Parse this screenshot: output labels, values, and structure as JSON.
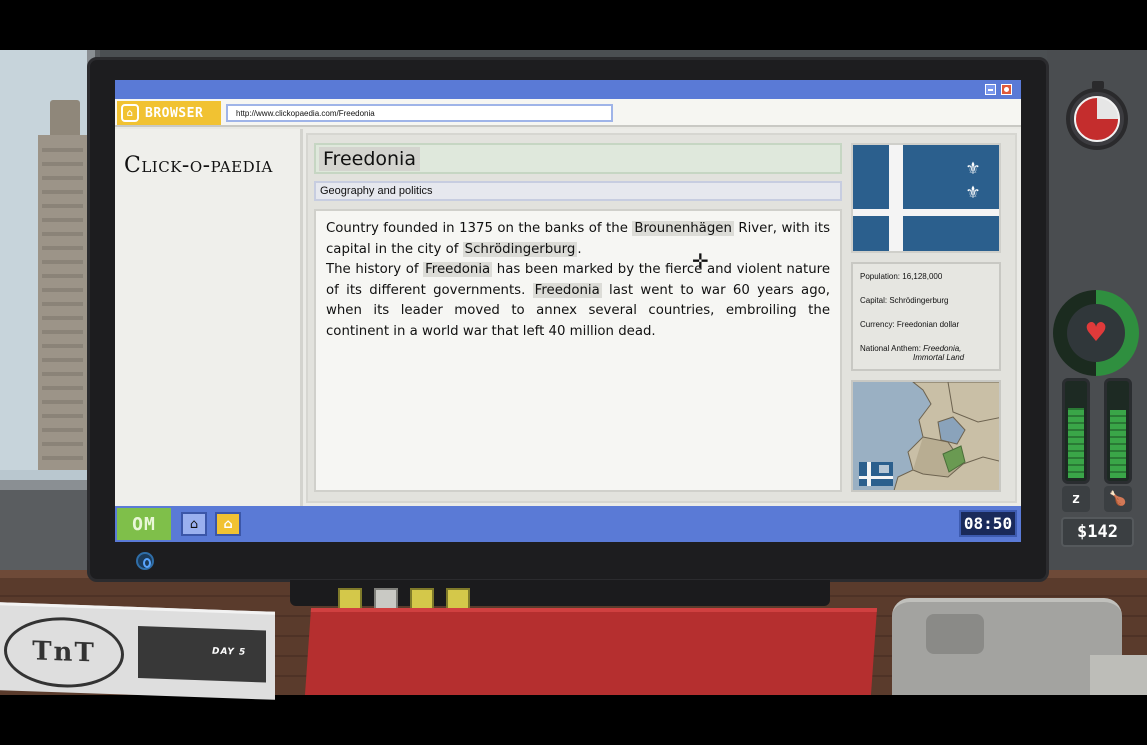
{
  "browser": {
    "label": "BROWSER",
    "logo_glyph": "⌂",
    "url": "http://www.clickopaedia.com/Freedonia"
  },
  "wiki": {
    "logo": "Click-o-paedia"
  },
  "article": {
    "title": "Freedonia",
    "section": "Geography and politics",
    "p1": [
      "Country founded in 1375 on the banks of the ",
      "Brounenhägen",
      " River, with its capital in the city of ",
      "Schrödingerburg",
      "."
    ],
    "p2": [
      "The history of ",
      "Freedonia",
      " has been marked by the fierce and violent nature of its different governments. ",
      "Freedonia",
      " last went to war 60 years ago, when its leader moved to annex several countries, embroiling the continent in a world war that left 40 million dead."
    ]
  },
  "infobox": {
    "population": "Population: 16,128,000",
    "capital": "Capital: Schrödingerburg",
    "currency": "Currency: Freedonian dollar",
    "anthem_label": "National Anthem: ",
    "anthem_value_1": "Freedonia,",
    "anthem_value_2": "Immortal Land"
  },
  "taskbar": {
    "start_label": "OM",
    "home_icon": "home-icon",
    "browser_icon": "browser-icon",
    "clock": "08:50"
  },
  "hud": {
    "money": "$142",
    "sleep_glyph": "z",
    "food_glyph": "🍗",
    "sleep_level": 0.75,
    "food_level": 0.72,
    "health_level": 0.5,
    "timer_remaining": 0.75
  },
  "newspaper": {
    "logo": "TnT",
    "day": "DAY 5"
  },
  "colors": {
    "taskbar": "#5a7ad6",
    "browser_accent": "#f1c232",
    "flag_blue": "#2b5f8d",
    "start_green": "#7fbf4a",
    "health_green": "#2f8f3f"
  }
}
